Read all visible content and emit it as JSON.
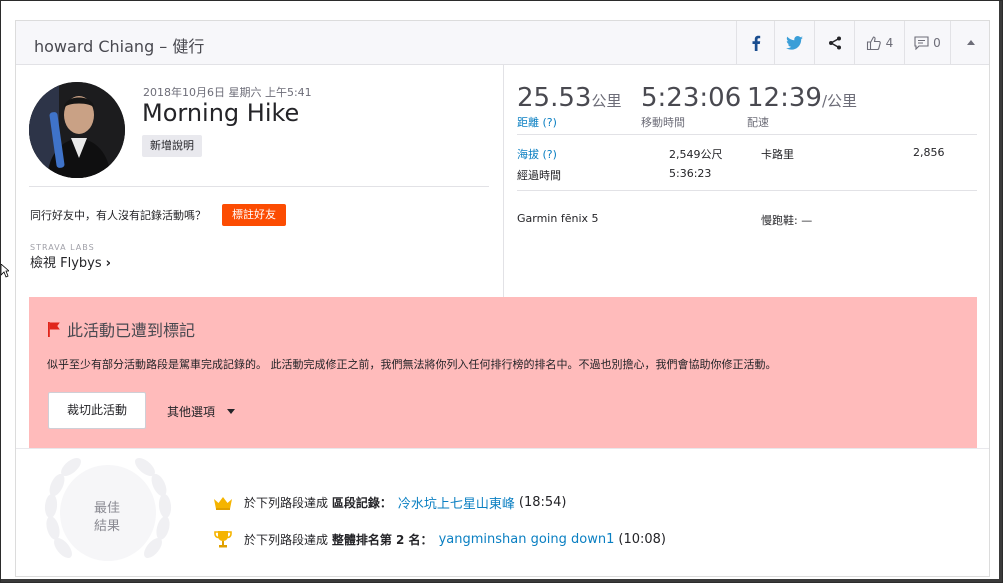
{
  "header": {
    "title": "howard Chiang – 健行",
    "kudos_count": "4",
    "comment_count": "0"
  },
  "activity": {
    "date": "2018年10月6日 星期六 上午5:41",
    "name": "Morning Hike",
    "add_description": "新增說明"
  },
  "tagging": {
    "question": "同行好友中，有人沒有記錄活動嗎？",
    "button": "標註好友"
  },
  "flybys": {
    "labs": "STRAVA LABS",
    "link": "檢視 Flybys"
  },
  "stats": {
    "distance": {
      "value": "25.53",
      "unit": "公里",
      "label": "距離 (?)"
    },
    "moving_time": {
      "value": "5:23:06",
      "label": "移動時間"
    },
    "pace": {
      "value": "12:39",
      "unit": "/公里",
      "label": "配速"
    }
  },
  "details": {
    "elevation_label": "海拔 (?)",
    "elevation_value": "2,549公尺",
    "calories_label": "卡路里",
    "calories_value": "2,856",
    "elapsed_label": "經過時間",
    "elapsed_value": "5:36:23",
    "device": "Garmin fēnix 5",
    "shoes": "慢跑鞋: —"
  },
  "flag": {
    "title": "此活動已遭到標記",
    "description": "似乎至少有部分活動路段是駕車完成記錄的。 此活動完成修正之前，我們無法將你列入任何排行榜的排名中。不過也別擔心，我們會協助你修正活動。",
    "crop_button": "裁切此活動",
    "more_options": "其他選項"
  },
  "best": {
    "label_line1": "最佳",
    "label_line2": "結果",
    "achievements": [
      {
        "prefix": "於下列路段達成",
        "type": "區段記錄：",
        "segment": "冷水坑上七星山東峰",
        "time": "(18:54)"
      },
      {
        "prefix": "於下列路段達成",
        "type": "整體排名第 2 名：",
        "segment": "yangminshan going down1",
        "time": "(10:08)"
      }
    ]
  },
  "colors": {
    "brand_orange": "#fc4c02",
    "link_blue": "#0a7fc2",
    "flag_bg": "#ffbbbb",
    "crown_gold": "#f5b400"
  }
}
